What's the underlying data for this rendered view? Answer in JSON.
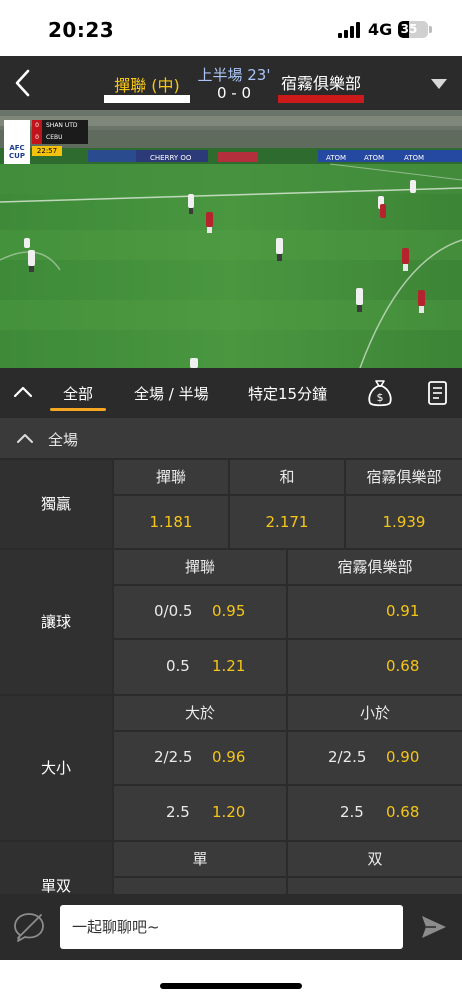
{
  "status_bar": {
    "time": "20:23",
    "network": "4G",
    "battery": "35",
    "battery_level": 0.35
  },
  "match": {
    "home_team": "撣聯 (中)",
    "away_team": "宿霧俱樂部",
    "period": "上半場 23'",
    "score": "0 - 0",
    "home_color": "#ffffff",
    "away_color": "#cc1a1a"
  },
  "video": {
    "scoreboard": {
      "competition": "AFC CUP",
      "team1": "SHAN UTD",
      "team1_score": "0",
      "team2": "CEBU",
      "team2_score": "0",
      "clock": "22:57"
    },
    "ads": [
      "CHERRY OO",
      "ATOM",
      "ATOM",
      "ATOM"
    ]
  },
  "tabs": {
    "all": "全部",
    "half": "全場 / 半場",
    "fifteen": "特定15分鐘",
    "active": "全部"
  },
  "section": {
    "title": "全場"
  },
  "markets": {
    "win": {
      "label": "獨贏",
      "headers": [
        "撣聯",
        "和",
        "宿霧俱樂部"
      ],
      "odds": [
        "1.181",
        "2.171",
        "1.939"
      ]
    },
    "handicap": {
      "label": "讓球",
      "headers": [
        "撣聯",
        "宿霧俱樂部"
      ],
      "rows": [
        {
          "home_line": "0/0.5",
          "home_odd": "0.95",
          "away_line": "",
          "away_odd": "0.91"
        },
        {
          "home_line": "0.5",
          "home_odd": "1.21",
          "away_line": "",
          "away_odd": "0.68"
        }
      ]
    },
    "over_under": {
      "label": "大小",
      "headers": [
        "大於",
        "小於"
      ],
      "rows": [
        {
          "over_line": "2/2.5",
          "over_odd": "0.96",
          "under_line": "2/2.5",
          "under_odd": "0.90"
        },
        {
          "over_line": "2.5",
          "over_odd": "1.20",
          "under_line": "2.5",
          "under_odd": "0.68"
        }
      ]
    },
    "odd_even": {
      "label": "單双",
      "headers": [
        "單",
        "双"
      ]
    }
  },
  "chat": {
    "placeholder": "一起聊聊吧~"
  },
  "colors": {
    "accent": "#f5a623",
    "odds": "#f5c518",
    "panel": "#2b2b2b",
    "cell": "#3a3a3a",
    "period": "#a9c4f5"
  }
}
